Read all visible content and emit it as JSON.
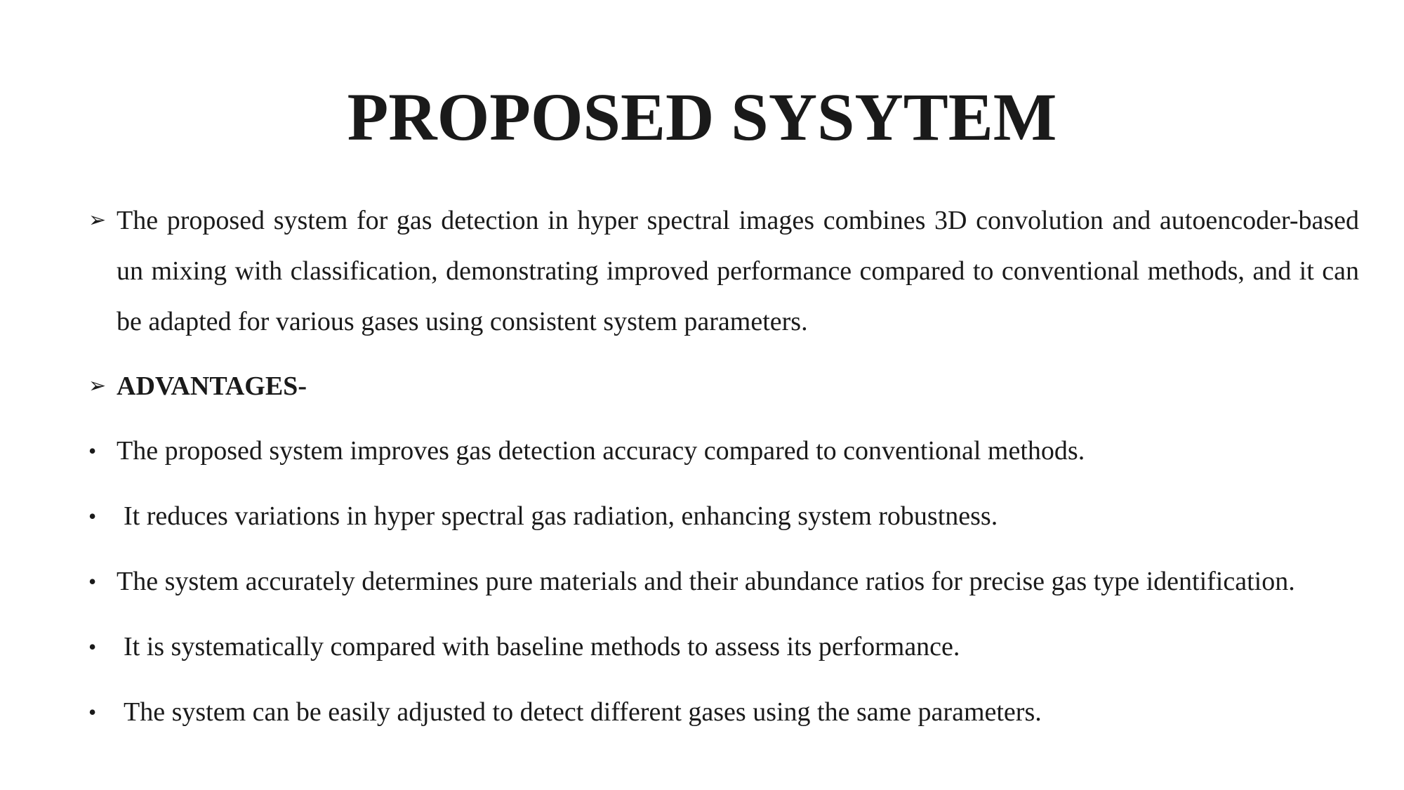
{
  "slide": {
    "title": "PROPOSED SYSYTEM",
    "intro": {
      "marker": "➢",
      "text": "The proposed system for gas detection in hyper spectral images combines 3D convolution and autoencoder-based un mixing with classification, demonstrating improved performance compared to conventional methods, and it can be adapted for various gases using consistent system parameters."
    },
    "advantages_heading": {
      "marker": "➢",
      "text": "ADVANTAGES-"
    },
    "bullet_marker": "•",
    "advantages": [
      "The proposed system improves gas detection accuracy compared to conventional methods.",
      "It reduces variations in hyper spectral gas radiation, enhancing system robustness.",
      "The system accurately determines pure materials and their abundance ratios for precise gas type identification.",
      "It is systematically compared with baseline methods to assess its performance.",
      "The system can be easily adjusted to detect different gases using the same parameters."
    ]
  }
}
